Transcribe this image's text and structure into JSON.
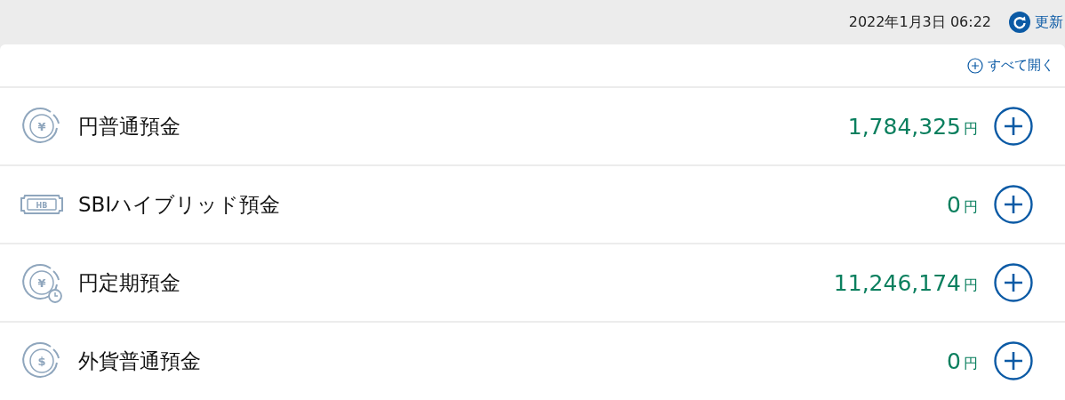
{
  "header": {
    "timestamp": "2022年1月3日 06:22",
    "refresh_label": "更新"
  },
  "expand_all_label": "すべて開く",
  "accounts": [
    {
      "kind": "yen",
      "icon_text": "¥",
      "name": "円普通預金",
      "amount": "1,784,325",
      "unit": "円"
    },
    {
      "kind": "hybrid",
      "icon_text": "HB",
      "name": "SBIハイブリッド預金",
      "amount": "0",
      "unit": "円"
    },
    {
      "kind": "yen-time",
      "icon_text": "¥",
      "name": "円定期預金",
      "amount": "11,246,174",
      "unit": "円"
    },
    {
      "kind": "dollar",
      "icon_text": "$",
      "name": "外貨普通預金",
      "amount": "0",
      "unit": "円"
    }
  ]
}
